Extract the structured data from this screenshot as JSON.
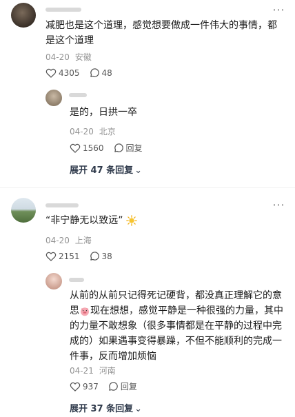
{
  "comments": [
    {
      "text": "减肥也是这个道理，感觉想要做成一件伟大的事情，都是这个道理",
      "time": "04-20",
      "location": "安徽",
      "likes": "4305",
      "replies": "48",
      "reply": {
        "text": "是的，日拱一卒",
        "time": "04-20",
        "location": "北京",
        "likes": "1560",
        "reply_label": "回复"
      },
      "expand_label": "展开 47 条回复"
    },
    {
      "text": "“非宁静无以致远”",
      "time": "04-20",
      "location": "上海",
      "likes": "2151",
      "replies": "38",
      "reply": {
        "text_a": "从前的从前只记得死记硬背，都没真正理解它的意思",
        "text_b": "现在想想，感觉平静是一种很强的力量，其中的力量不敢想象（很多事情都是在平静的过程中完成的）如果遇事变得暴躁，不但不能顺利的完成一件事，反而增加烦恼",
        "time": "04-21",
        "location": "河南",
        "likes": "937",
        "reply_label": "回复"
      },
      "expand_label": "展开 37 条回复"
    }
  ],
  "icons": {
    "like": "heart-icon",
    "comment": "comment-icon",
    "more": "more-icon",
    "chevron": "chevron-down-icon"
  },
  "glyphs": {
    "more": "⋯",
    "chevron": "⌄"
  },
  "colors": {
    "meta": "#939393",
    "expand": "#2f3a4b"
  }
}
